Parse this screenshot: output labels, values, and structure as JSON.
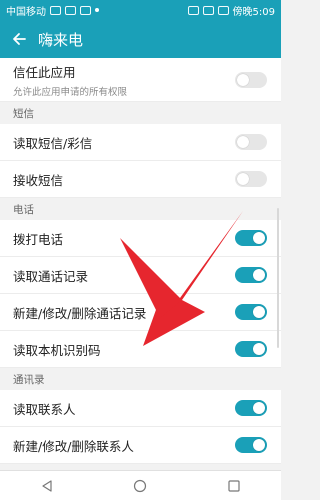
{
  "status": {
    "carrier": "中国移动",
    "time": "傍晚5:09"
  },
  "header": {
    "title": "嗨来电"
  },
  "top": {
    "label": "信任此应用",
    "sub": "允许此应用申请的所有权限",
    "enabled": false
  },
  "sections": [
    {
      "title": "短信",
      "items": [
        {
          "label": "读取短信/彩信",
          "enabled": false
        },
        {
          "label": "接收短信",
          "enabled": false
        }
      ]
    },
    {
      "title": "电话",
      "items": [
        {
          "label": "拨打电话",
          "enabled": true
        },
        {
          "label": "读取通话记录",
          "enabled": true
        },
        {
          "label": "新建/修改/删除通话记录",
          "enabled": true
        },
        {
          "label": "读取本机识别码",
          "enabled": true
        }
      ]
    },
    {
      "title": "通讯录",
      "items": [
        {
          "label": "读取联系人",
          "enabled": true
        },
        {
          "label": "新建/修改/删除联系人",
          "enabled": true
        }
      ]
    }
  ],
  "colors": {
    "accent": "#1aa0b8",
    "arrow": "#e6262e"
  }
}
